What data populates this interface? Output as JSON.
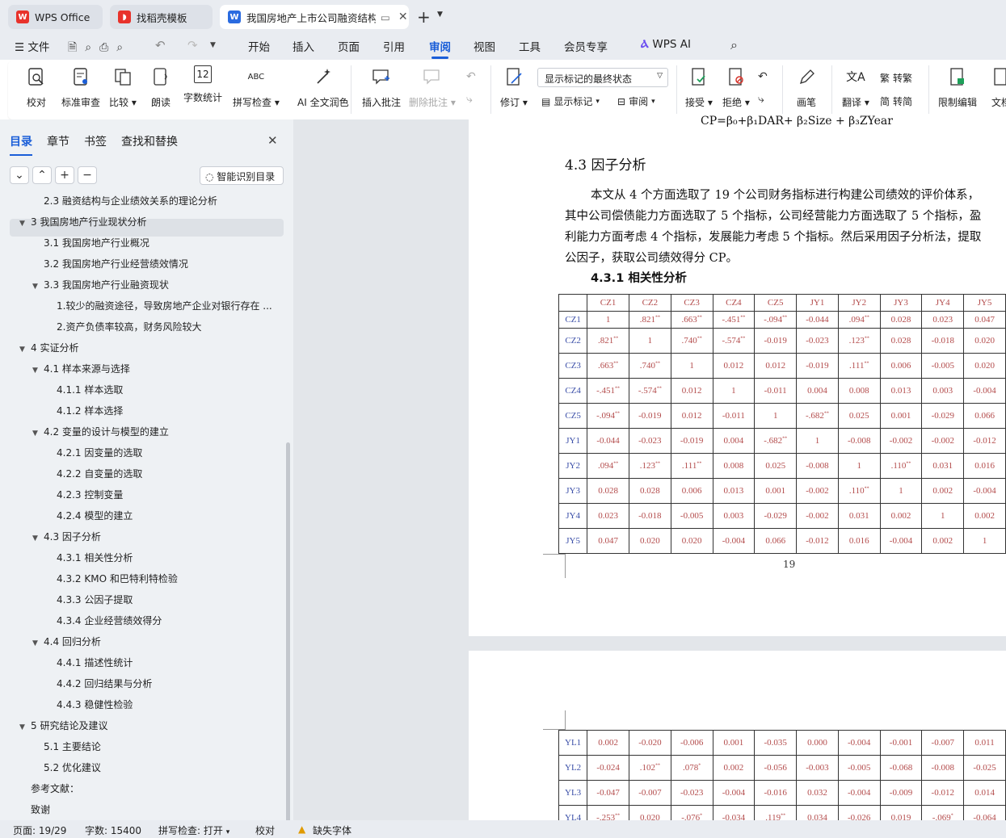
{
  "tabs": [
    {
      "label": "WPS Office"
    },
    {
      "label": "找稻壳模板"
    },
    {
      "label": "我国房地产上市公司融资结构"
    }
  ],
  "menu": {
    "file": "文件",
    "items": [
      "开始",
      "插入",
      "页面",
      "引用",
      "审阅",
      "视图",
      "工具",
      "会员专享"
    ],
    "wps_ai": "WPS AI",
    "active": "审阅"
  },
  "ribbon": {
    "proofread": "校对",
    "std_review": "标准审查",
    "compare": "比较",
    "read": "朗读",
    "word_count": "字数统计",
    "spell": "拼写检查",
    "ai_polish": "AI 全文润色",
    "insert_comment": "插入批注",
    "delete_comment": "删除批注",
    "revise": "修订",
    "display_dropdown": "显示标记的最终状态",
    "show_markup": "显示标记",
    "review": "审阅",
    "accept": "接受",
    "reject": "拒绝",
    "pen": "画笔",
    "translate": "翻译",
    "to_trad": "转繁",
    "to_simp": "转简",
    "restrict": "限制编辑",
    "doc": "文档"
  },
  "panel": {
    "tabs": [
      "目录",
      "章节",
      "书签",
      "查找和替换"
    ],
    "smart_btn": "智能识别目录",
    "toc": [
      {
        "label": "2.3 融资结构与企业绩效关系的理论分析",
        "level": 1,
        "caret": ""
      },
      {
        "label": "3  我国房地产行业现状分析",
        "level": 0,
        "caret": "▼"
      },
      {
        "label": "3.1 我国房地产行业概况",
        "level": 1,
        "caret": ""
      },
      {
        "label": "3.2 我国房地产行业经营绩效情况",
        "level": 1,
        "caret": ""
      },
      {
        "label": "3.3 我国房地产行业融资现状",
        "level": 1,
        "caret": "▼"
      },
      {
        "label": "1.较少的融资途径，导致房地产企业对银行存在 ...",
        "level": 2,
        "caret": ""
      },
      {
        "label": "2.资产负债率较高，财务风险较大",
        "level": 2,
        "caret": ""
      },
      {
        "label": "4  实证分析",
        "level": 0,
        "caret": "▼"
      },
      {
        "label": "4.1 样本来源与选择",
        "level": 1,
        "caret": "▼"
      },
      {
        "label": "4.1.1 样本选取",
        "level": 2,
        "caret": ""
      },
      {
        "label": "4.1.2 样本选择",
        "level": 2,
        "caret": ""
      },
      {
        "label": "4.2 变量的设计与模型的建立",
        "level": 1,
        "caret": "▼"
      },
      {
        "label": "4.2.1 因变量的选取",
        "level": 2,
        "caret": ""
      },
      {
        "label": "4.2.2 自变量的选取",
        "level": 2,
        "caret": ""
      },
      {
        "label": "4.2.3  控制变量",
        "level": 2,
        "caret": ""
      },
      {
        "label": "4.2.4  模型的建立",
        "level": 2,
        "caret": ""
      },
      {
        "label": "4.3  因子分析",
        "level": 1,
        "caret": "▼"
      },
      {
        "label": "4.3.1 相关性分析",
        "level": 2,
        "caret": ""
      },
      {
        "label": "4.3.2 KMO 和巴特利特检验",
        "level": 2,
        "caret": ""
      },
      {
        "label": "4.3.3 公因子提取",
        "level": 2,
        "caret": ""
      },
      {
        "label": "4.3.4 企业经营绩效得分",
        "level": 2,
        "caret": ""
      },
      {
        "label": "4.4 回归分析",
        "level": 1,
        "caret": "▼"
      },
      {
        "label": "4.4.1 描述性统计",
        "level": 2,
        "caret": ""
      },
      {
        "label": "4.4.2 回归结果与分析",
        "level": 2,
        "caret": ""
      },
      {
        "label": "4.4.3 稳健性检验",
        "level": 2,
        "caret": ""
      },
      {
        "label": "5  研究结论及建议",
        "level": 0,
        "caret": "▼"
      },
      {
        "label": "5.1 主要结论",
        "level": 1,
        "caret": ""
      },
      {
        "label": "5.2 优化建议",
        "level": 1,
        "caret": ""
      },
      {
        "label": "参考文献：",
        "level": 0,
        "caret": ""
      },
      {
        "label": "致谢",
        "level": 0,
        "caret": ""
      }
    ]
  },
  "doc": {
    "formula": "CP=β₀+β₁DAR+ β₂Size + β₃ZYear",
    "heading": "4.3  因子分析",
    "para": [
      "本文从 4 个方面选取了 19 个公司财务指标进行构建公司绩效的评价体系，",
      "其中公司偿债能力方面选取了 5 个指标，公司经营能力方面选取了 5 个指标，盈",
      "利能力方面考虑 4 个指标，发展能力考虑 5 个指标。然后采用因子分析法，提取",
      "公因子，获取公司绩效得分 CP。"
    ],
    "subheading": "4.3.1 相关性分析",
    "page_number": "19",
    "table_header": [
      "CZ1",
      "CZ2",
      "CZ3",
      "CZ4",
      "CZ5",
      "JY1",
      "JY2",
      "JY3",
      "JY4",
      "JY5"
    ],
    "table_rows": [
      {
        "h": "CZ1",
        "c": [
          "1",
          ".821**",
          ".663**",
          "-.451**",
          "-.094**",
          "-0.044",
          ".094**",
          "0.028",
          "0.023",
          "0.047"
        ]
      },
      {
        "h": "CZ2",
        "c": [
          ".821**",
          "1",
          ".740**",
          "-.574**",
          "-0.019",
          "-0.023",
          ".123**",
          "0.028",
          "-0.018",
          "0.020"
        ]
      },
      {
        "h": "CZ3",
        "c": [
          ".663**",
          ".740**",
          "1",
          "0.012",
          "0.012",
          "-0.019",
          ".111**",
          "0.006",
          "-0.005",
          "0.020"
        ]
      },
      {
        "h": "CZ4",
        "c": [
          "-.451**",
          "-.574**",
          "0.012",
          "1",
          "-0.011",
          "0.004",
          "0.008",
          "0.013",
          "0.003",
          "-0.004"
        ]
      },
      {
        "h": "CZ5",
        "c": [
          "-.094**",
          "-0.019",
          "0.012",
          "-0.011",
          "1",
          "-.682**",
          "0.025",
          "0.001",
          "-0.029",
          "0.066"
        ]
      },
      {
        "h": "JY1",
        "c": [
          "-0.044",
          "-0.023",
          "-0.019",
          "0.004",
          "-.682**",
          "1",
          "-0.008",
          "-0.002",
          "-0.002",
          "-0.012"
        ]
      },
      {
        "h": "JY2",
        "c": [
          ".094**",
          ".123**",
          ".111**",
          "0.008",
          "0.025",
          "-0.008",
          "1",
          ".110**",
          "0.031",
          "0.016"
        ]
      },
      {
        "h": "JY3",
        "c": [
          "0.028",
          "0.028",
          "0.006",
          "0.013",
          "0.001",
          "-0.002",
          ".110**",
          "1",
          "0.002",
          "-0.004"
        ]
      },
      {
        "h": "JY4",
        "c": [
          "0.023",
          "-0.018",
          "-0.005",
          "0.003",
          "-0.029",
          "-0.002",
          "0.031",
          "0.002",
          "1",
          "0.002"
        ]
      },
      {
        "h": "JY5",
        "c": [
          "0.047",
          "0.020",
          "0.020",
          "-0.004",
          "0.066",
          "-0.012",
          "0.016",
          "-0.004",
          "0.002",
          "1"
        ]
      }
    ],
    "table2_rows": [
      {
        "h": "YL1",
        "c": [
          "0.002",
          "-0.020",
          "-0.006",
          "0.001",
          "-0.035",
          "0.000",
          "-0.004",
          "-0.001",
          "-0.007",
          "0.011"
        ]
      },
      {
        "h": "YL2",
        "c": [
          "-0.024",
          ".102**",
          ".078*",
          "0.002",
          "-0.056",
          "-0.003",
          "-0.005",
          "-0.068",
          "-0.008",
          "-0.025"
        ]
      },
      {
        "h": "YL3",
        "c": [
          "-0.047",
          "-0.007",
          "-0.023",
          "-0.004",
          "-0.016",
          "0.032",
          "-0.004",
          "-0.009",
          "-0.012",
          "0.014"
        ]
      },
      {
        "h": "YL4",
        "c": [
          "-.253**",
          "0.020",
          "-.076*",
          "-0.034",
          ".119**",
          "0.034",
          "-0.026",
          "0.019",
          "-.069*",
          "-0.064"
        ]
      }
    ]
  },
  "status": {
    "page": "页面: 19/29",
    "words": "字数: 15400",
    "spell": "拼写检查: 打开",
    "proof": "校对",
    "missing_font": "缺失字体"
  }
}
